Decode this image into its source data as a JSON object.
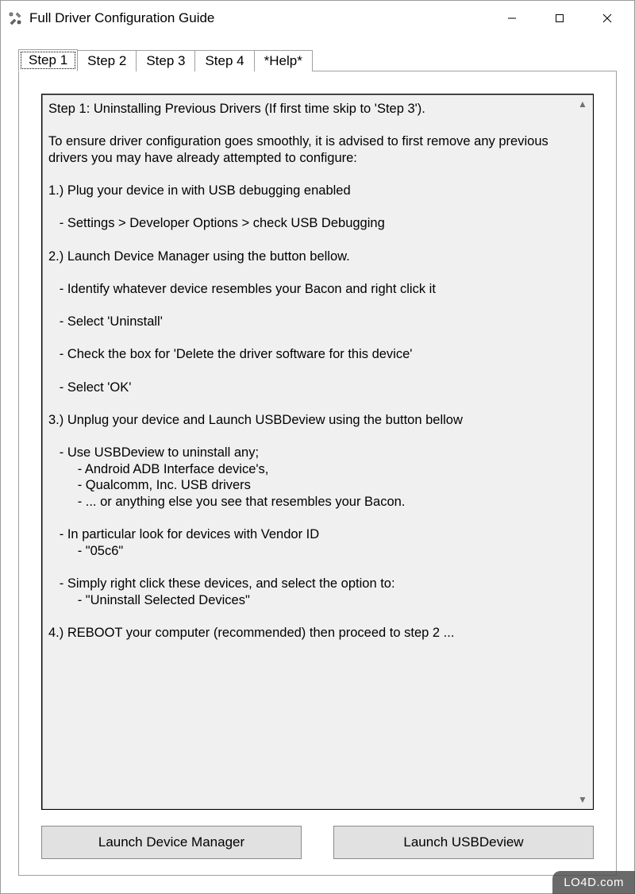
{
  "window": {
    "title": "Full Driver Configuration Guide"
  },
  "tabs": [
    {
      "label": "Step 1",
      "active": true
    },
    {
      "label": "Step 2",
      "active": false
    },
    {
      "label": "Step 3",
      "active": false
    },
    {
      "label": "Step 4",
      "active": false
    },
    {
      "label": "*Help*",
      "active": false
    }
  ],
  "content": "Step 1: Uninstalling Previous Drivers (If first time skip to 'Step 3').\n\nTo ensure driver configuration goes smoothly, it is advised to first remove any previous drivers you may have already attempted to configure:\n\n1.) Plug your device in with USB debugging enabled\n\n   - Settings > Developer Options > check USB Debugging\n\n2.) Launch Device Manager using the button bellow.\n\n   - Identify whatever device resembles your Bacon and right click it\n\n   - Select 'Uninstall'\n\n   - Check the box for 'Delete the driver software for this device'\n\n   - Select 'OK'\n\n3.) Unplug your device and Launch USBDeview using the button bellow\n\n   - Use USBDeview to uninstall any;\n        - Android ADB Interface device's,\n        - Qualcomm, Inc. USB drivers\n        - ... or anything else you see that resembles your Bacon.\n\n   - In particular look for devices with Vendor ID\n        - \"05c6\"\n\n   - Simply right click these devices, and select the option to:\n        - \"Uninstall Selected Devices\"\n\n4.) REBOOT your computer (recommended) then proceed to step 2 ...",
  "buttons": {
    "device_manager": "Launch Device Manager",
    "usbdeview": "Launch USBDeview"
  },
  "watermark": "LO4D.com"
}
